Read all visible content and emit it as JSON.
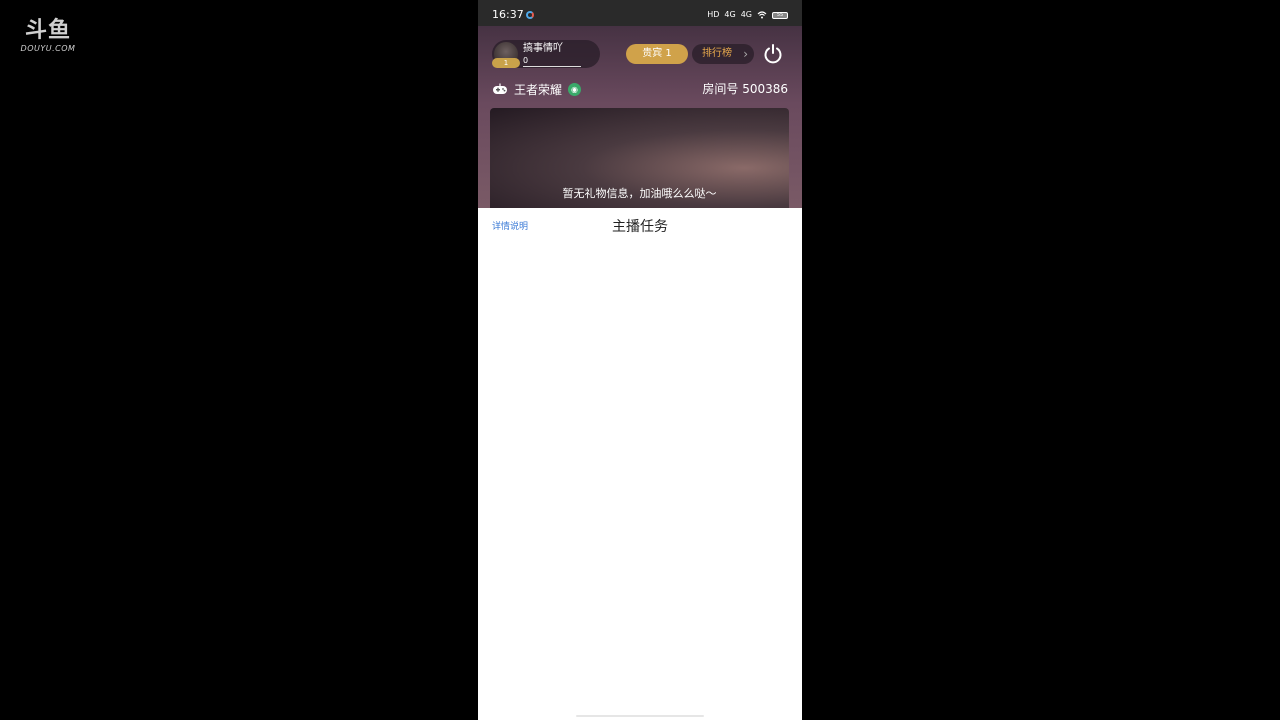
{
  "watermark": {
    "logo": "斗鱼",
    "sub": "DOUYU.COM"
  },
  "status_bar": {
    "time": "16:37",
    "network_1": "HD",
    "network_2": "4G",
    "network_3": "4G",
    "battery": "55"
  },
  "user": {
    "name": "搞事情吖",
    "level": "1",
    "count": "0"
  },
  "buttons": {
    "vip": "贵宾 1",
    "rank": "排行榜"
  },
  "game": {
    "name": "王者荣耀"
  },
  "room": {
    "label": "房间号 500386"
  },
  "gift_panel": {
    "empty_text": "暂无礼物信息，加油哦么么哒～"
  },
  "task": {
    "detail_link": "详情说明",
    "title": "主播任务"
  },
  "colors": {
    "vip_gold": "#d0a24a",
    "rank_text": "#e7a94c",
    "link_blue": "#3a7ad6",
    "signal_green": "#3aaa6a"
  }
}
